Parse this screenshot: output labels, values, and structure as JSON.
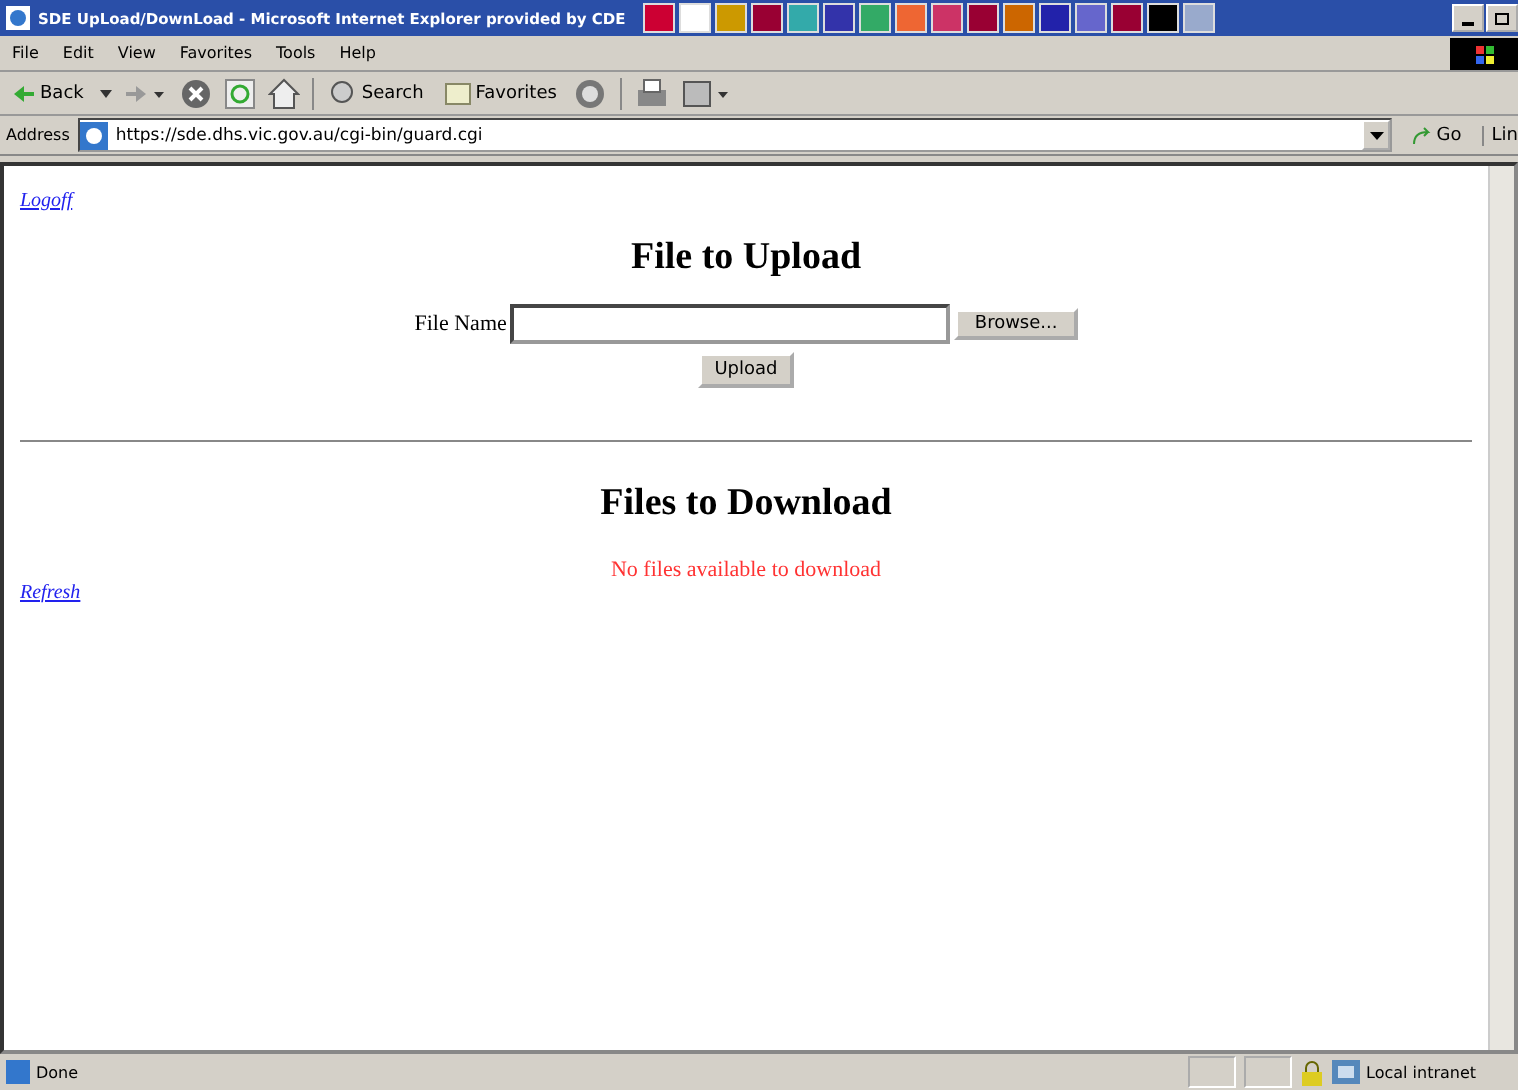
{
  "window": {
    "title": "SDE UpLoad/DownLoad - Microsoft Internet Explorer provided by CDE"
  },
  "menu": [
    "File",
    "Edit",
    "View",
    "Favorites",
    "Tools",
    "Help"
  ],
  "toolbar": {
    "back": "Back",
    "search": "Search",
    "favorites": "Favorites"
  },
  "address_bar": {
    "label": "Address",
    "value": "https://sde.dhs.vic.gov.au/cgi-bin/guard.cgi",
    "go": "Go",
    "links": "Lin"
  },
  "page": {
    "logoff": "Logoff",
    "upload_heading": "File to Upload",
    "file_label": "File Name",
    "browse": "Browse...",
    "upload": "Upload",
    "download_heading": "Files to Download",
    "empty_message": "No files available to download",
    "refresh": "Refresh"
  },
  "status_bar": {
    "text": "Done",
    "zone": "Local intranet"
  }
}
